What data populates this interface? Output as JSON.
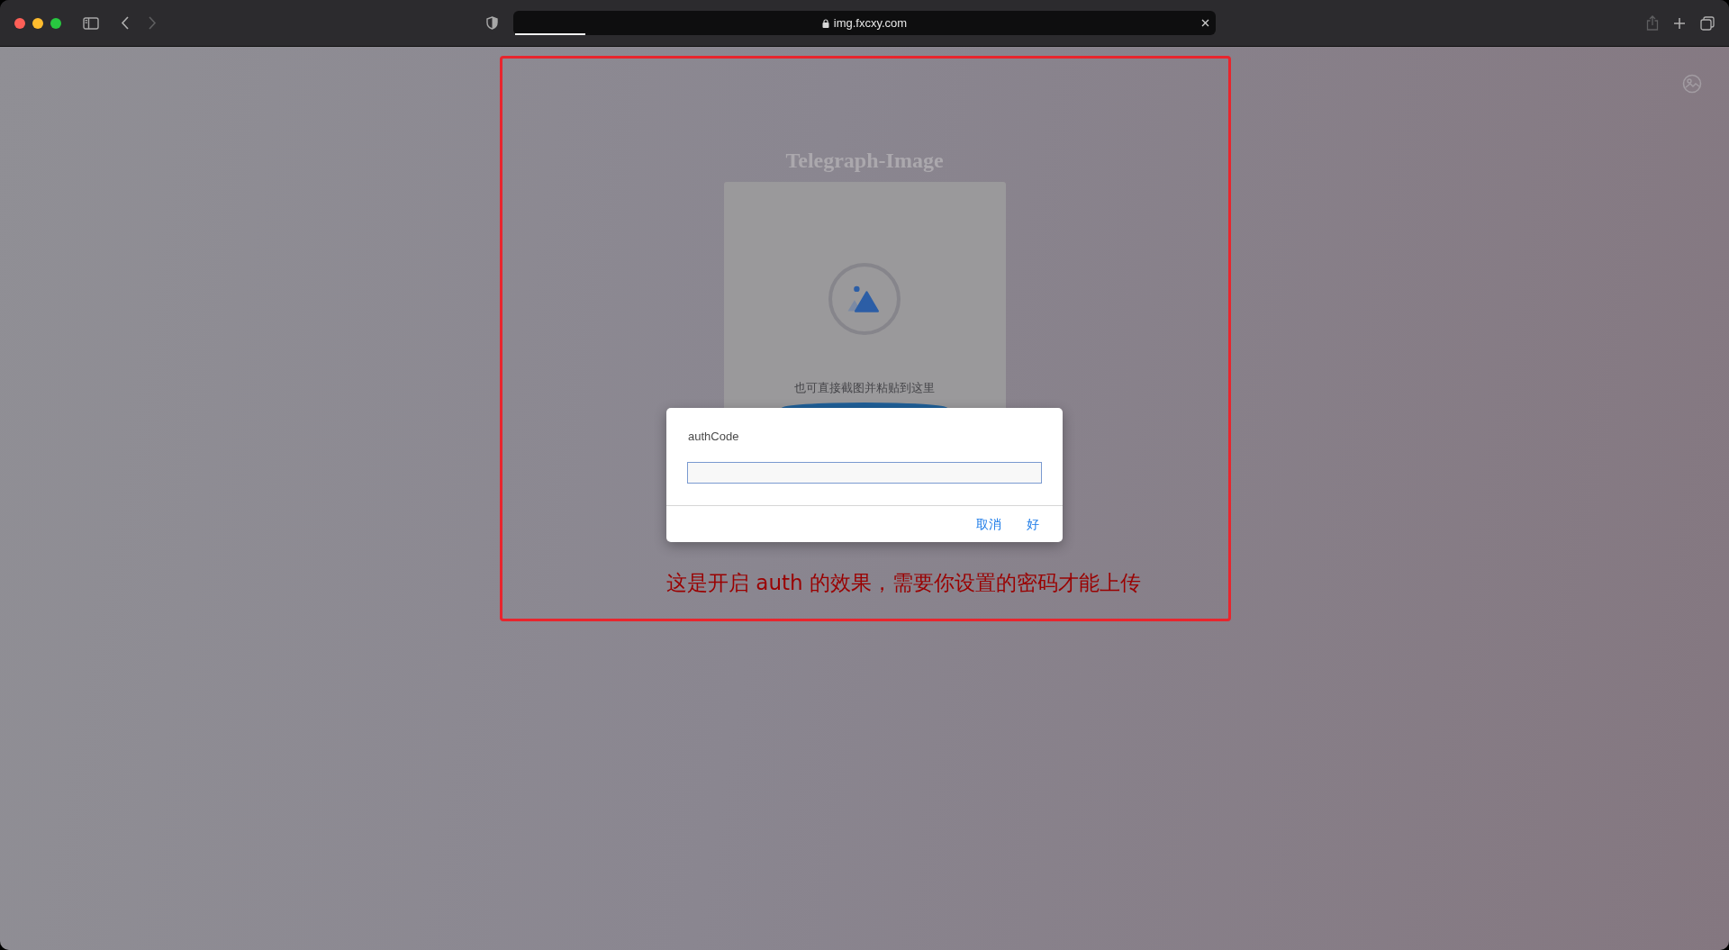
{
  "browser": {
    "nav_buttons": [
      {
        "kind": "back",
        "disabled": false
      },
      {
        "kind": "forward",
        "disabled": true
      }
    ],
    "url": "img.fxcxy.com",
    "load_progress": {
      "level": 0.1
    },
    "share_disabled": true
  },
  "page": {
    "title": "Telegraph-Image",
    "upload_card": {
      "hint": "也可直接截图并粘贴到这里"
    }
  },
  "dialog": {
    "label": "authCode",
    "buttons": [
      "取消",
      "好"
    ]
  },
  "annotation": {
    "text": "这是开启 auth 的效果，需要你设置的密码才能上传"
  }
}
